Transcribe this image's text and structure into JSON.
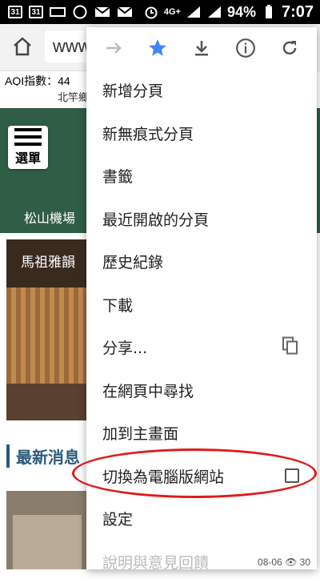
{
  "status_bar": {
    "calendar_a": "31",
    "calendar_b": "31",
    "network": "4G+",
    "battery": "94%",
    "time": "7:07"
  },
  "toolbar": {
    "url_text": "www"
  },
  "page": {
    "aqi_label": "AQI指數：44",
    "top_text": "北竿鄉",
    "menu_label": "選單",
    "airport": "松山機場",
    "photo_caption": "馬祖雅韻",
    "news_header": "最新消息",
    "date": "08-06",
    "views": "30"
  },
  "menu": {
    "items": [
      {
        "label": "新增分頁"
      },
      {
        "label": "新無痕式分頁"
      },
      {
        "label": "書籤"
      },
      {
        "label": "最近開啟的分頁"
      },
      {
        "label": "歷史紀錄"
      },
      {
        "label": "下載"
      },
      {
        "label": "分享..."
      },
      {
        "label": "在網頁中尋找"
      },
      {
        "label": "加到主畫面"
      },
      {
        "label": "切換為電腦版網站"
      },
      {
        "label": "設定"
      },
      {
        "label": "說明與意見回饋"
      }
    ],
    "accent_color": "#4285f4"
  }
}
